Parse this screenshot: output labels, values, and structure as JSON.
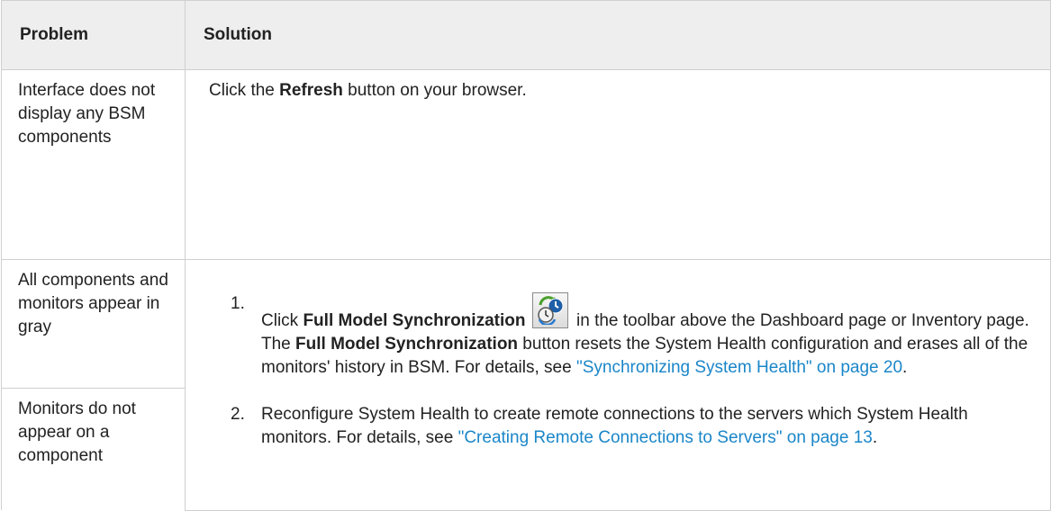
{
  "table": {
    "headers": {
      "problem": "Problem",
      "solution": "Solution"
    },
    "row1": {
      "problem": "Interface does not display any BSM components",
      "solution": {
        "pre": "Click the ",
        "bold": "Refresh",
        "post": " button on your browser."
      }
    },
    "row2": {
      "problem": "All components and monitors appear in gray"
    },
    "row3": {
      "problem": "Monitors do not appear on a component"
    },
    "shared_solution": {
      "step1": {
        "number": "1.",
        "pre": "Click ",
        "bold1": "Full Model Synchronization",
        "icon": "full-model-synchronization-icon",
        "mid1": " in the toolbar above the Dashboard page or Inventory page. The ",
        "bold2": "Full Model Synchronization",
        "mid2": " button resets the System Health configuration and erases all of the monitors' history in BSM. For details, see ",
        "link": "\"Synchronizing System Health\" on page 20",
        "post": "."
      },
      "step2": {
        "number": "2.",
        "pre": "Reconfigure System Health to create remote connections to the servers which System Health monitors. For details, see ",
        "link": "\"Creating Remote Connections to Servers\" on page 13",
        "post": "."
      }
    }
  },
  "colors": {
    "link": "#1a86c8",
    "header_bg": "#eeeeee",
    "border": "#cfcfcf"
  }
}
